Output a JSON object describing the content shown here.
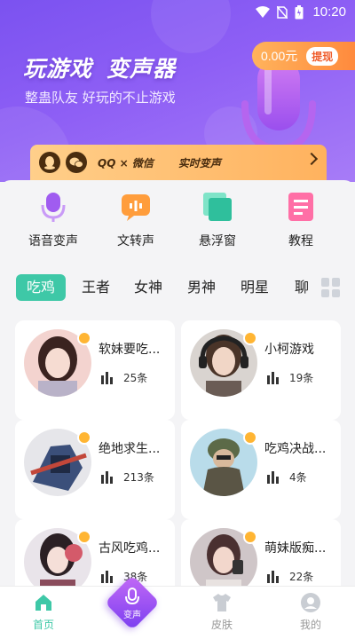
{
  "statusbar": {
    "time": "10:20"
  },
  "hero": {
    "title_a": "玩游戏",
    "title_b": "变声器",
    "subtitle": "整蛊队友 好玩的不止游戏",
    "balance": "0.00元",
    "withdraw_label": "提现"
  },
  "banner": {
    "qq_wechat": "QQ × 微信",
    "realtime": "实时变声"
  },
  "tools": [
    {
      "label": "语音变声",
      "icon": "mic-icon"
    },
    {
      "label": "文转声",
      "icon": "text-to-speech-icon"
    },
    {
      "label": "悬浮窗",
      "icon": "floating-window-icon"
    },
    {
      "label": "教程",
      "icon": "tutorial-icon"
    }
  ],
  "tabs": [
    "吃鸡",
    "王者",
    "女神",
    "男神",
    "明星",
    "聊"
  ],
  "cards": [
    {
      "title": "软妹要吃...",
      "count": "25条"
    },
    {
      "title": "小柯游戏",
      "count": "19条"
    },
    {
      "title": "绝地求生...",
      "count": "213条"
    },
    {
      "title": "吃鸡决战...",
      "count": "4条"
    },
    {
      "title": "古风吃鸡...",
      "count": "38条"
    },
    {
      "title": "萌妹版痴...",
      "count": "22条"
    }
  ],
  "nav": {
    "home": "首页",
    "voice": "变声",
    "skin": "皮肤",
    "mine": "我的"
  },
  "colors": {
    "accent": "#3ec8a7",
    "hero": "#8e5ff5",
    "balance": "#ff8a3d"
  }
}
